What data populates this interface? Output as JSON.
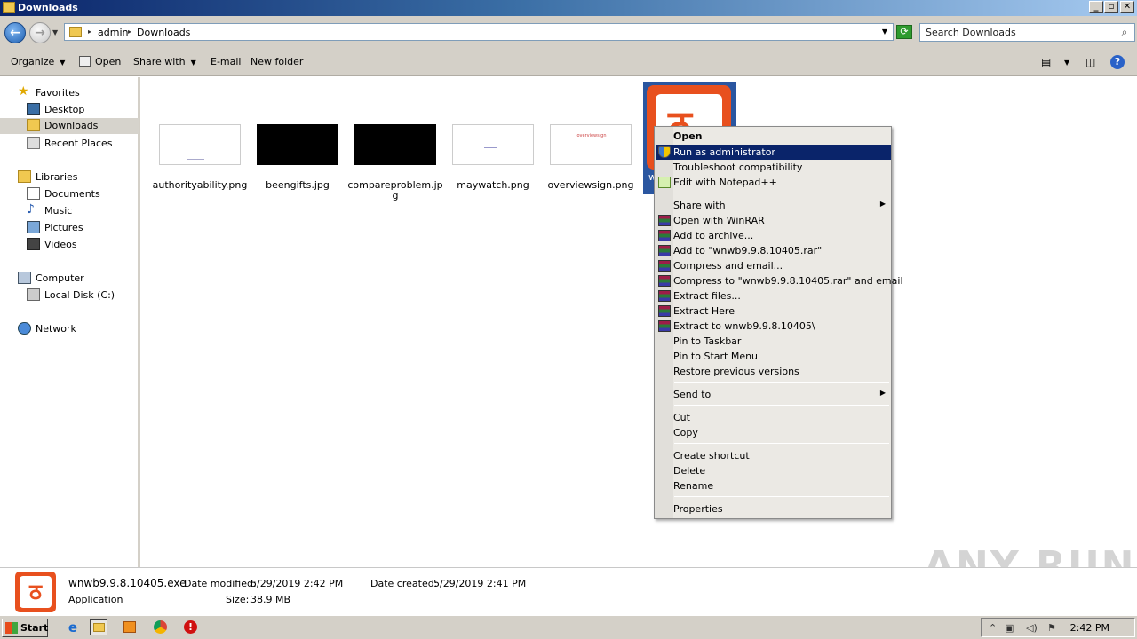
{
  "window": {
    "title": "Downloads",
    "buttons": [
      "_",
      "▫",
      "✕"
    ]
  },
  "address": {
    "crumbs": [
      "admin",
      "Downloads"
    ],
    "search_placeholder": "Search Downloads"
  },
  "toolbar": {
    "organize": "Organize",
    "open": "Open",
    "share_with": "Share with",
    "email": "E-mail",
    "new_folder": "New folder"
  },
  "nav": {
    "favorites": "Favorites",
    "desktop": "Desktop",
    "downloads": "Downloads",
    "recent": "Recent Places",
    "libraries": "Libraries",
    "documents": "Documents",
    "music": "Music",
    "pictures": "Pictures",
    "videos": "Videos",
    "computer": "Computer",
    "local_disk": "Local Disk (C:)",
    "network": "Network"
  },
  "files": [
    {
      "name": "authorityability.png",
      "thumb_text": ""
    },
    {
      "name": "beengifts.jpg",
      "thumb_text": ""
    },
    {
      "name": "compareproblem.jpg",
      "thumb_text": ""
    },
    {
      "name": "maywatch.png",
      "thumb_text": ""
    },
    {
      "name": "overviewsign.png",
      "thumb_text": "overviewsign"
    }
  ],
  "selected_file": {
    "partial_label": "w"
  },
  "context_menu": {
    "open": "Open",
    "run_as_admin": "Run as administrator",
    "troubleshoot": "Troubleshoot compatibility",
    "edit_npp": "Edit with Notepad++",
    "share_with": "Share with",
    "open_winrar": "Open with WinRAR",
    "add_archive": "Add to archive...",
    "add_to_rar": "Add to \"wnwb9.9.8.10405.rar\"",
    "compress_email": "Compress and email...",
    "compress_to_rar_email": "Compress to \"wnwb9.9.8.10405.rar\" and email",
    "extract_files": "Extract files...",
    "extract_here": "Extract Here",
    "extract_to": "Extract to wnwb9.9.8.10405\\",
    "pin_taskbar": "Pin to Taskbar",
    "pin_start": "Pin to Start Menu",
    "restore_prev": "Restore previous versions",
    "send_to": "Send to",
    "cut": "Cut",
    "copy": "Copy",
    "create_shortcut": "Create shortcut",
    "delete": "Delete",
    "rename": "Rename",
    "properties": "Properties"
  },
  "details": {
    "filename": "wnwb9.9.8.10405.exe",
    "type": "Application",
    "date_modified_label": "Date modified:",
    "date_modified": "5/29/2019 2:42 PM",
    "date_created_label": "Date created:",
    "date_created": "5/29/2019 2:41 PM",
    "size_label": "Size:",
    "size": "38.9 MB"
  },
  "watermark": "ANY RUN",
  "taskbar": {
    "start": "Start",
    "clock": "2:42 PM"
  }
}
